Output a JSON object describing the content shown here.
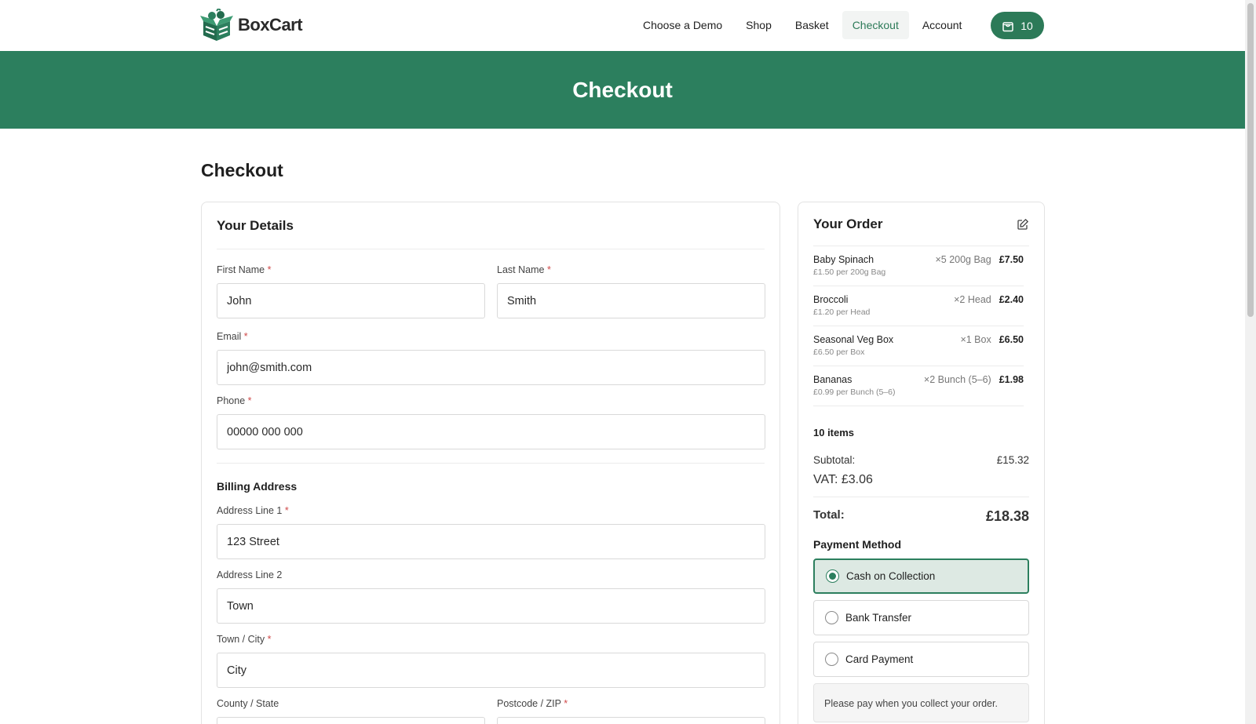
{
  "header": {
    "brand": "BoxCart",
    "nav": [
      "Choose a Demo",
      "Shop",
      "Basket",
      "Checkout",
      "Account"
    ],
    "active_nav": "Checkout",
    "cart_count": "10"
  },
  "hero": {
    "title": "Checkout"
  },
  "page_title": "Checkout",
  "details": {
    "title": "Your Details",
    "first_name": {
      "label": "First Name",
      "value": "John"
    },
    "last_name": {
      "label": "Last Name",
      "value": "Smith"
    },
    "email": {
      "label": "Email",
      "value": "john@smith.com"
    },
    "phone": {
      "label": "Phone",
      "value": "00000 000 000"
    },
    "billing_title": "Billing Address",
    "address1": {
      "label": "Address Line 1",
      "value": "123 Street"
    },
    "address2": {
      "label": "Address Line 2",
      "value": "Town"
    },
    "town": {
      "label": "Town / City",
      "value": "City"
    },
    "county": {
      "label": "County / State",
      "value": ""
    },
    "postcode": {
      "label": "Postcode / ZIP",
      "value": ""
    },
    "required_mark": "*"
  },
  "order": {
    "title": "Your Order",
    "items": [
      {
        "name": "Baby Spinach",
        "unit": "£1.50 per 200g Bag",
        "qty": "×5 200g Bag",
        "price": "£7.50"
      },
      {
        "name": "Broccoli",
        "unit": "£1.20 per Head",
        "qty": "×2 Head",
        "price": "£2.40"
      },
      {
        "name": "Seasonal Veg Box",
        "unit": "£6.50 per Box",
        "qty": "×1 Box",
        "price": "£6.50"
      },
      {
        "name": "Bananas",
        "unit": "£0.99 per Bunch (5–6)",
        "qty": "×2 Bunch (5–6)",
        "price": "£1.98"
      }
    ],
    "count": "10 items",
    "subtotal_label": "Subtotal:",
    "subtotal": "£15.32",
    "vat": "VAT: £3.06",
    "total_label": "Total:",
    "total": "£18.38",
    "payment_title": "Payment Method",
    "payment_options": [
      "Cash on Collection",
      "Bank Transfer",
      "Card Payment"
    ],
    "selected_payment": "Cash on Collection",
    "payment_note": "Please pay when you collect your order."
  },
  "colors": {
    "brand_green": "#2c7f5e",
    "selected_bg": "#dde9e3",
    "required": "#d04a4a"
  }
}
